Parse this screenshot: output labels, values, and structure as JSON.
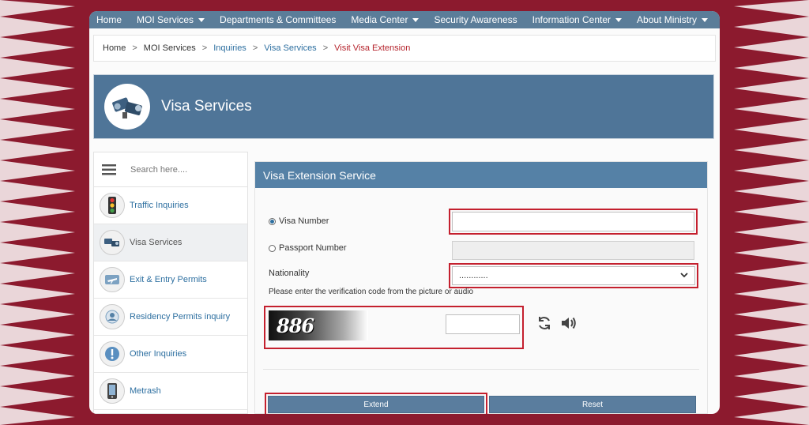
{
  "colors": {
    "maroon": "#7a1426",
    "accent": "#5581a6",
    "highlight": "#c4202e"
  },
  "topnav": [
    {
      "label": "Home",
      "dropdown": false
    },
    {
      "label": "MOI Services",
      "dropdown": true
    },
    {
      "label": "Departments & Committees",
      "dropdown": false
    },
    {
      "label": "Media Center",
      "dropdown": true
    },
    {
      "label": "Security Awareness",
      "dropdown": false
    },
    {
      "label": "Information Center",
      "dropdown": true
    },
    {
      "label": "About Ministry",
      "dropdown": true
    }
  ],
  "breadcrumb": {
    "home": "Home",
    "moi_services": "MOI Services",
    "inquiries": "Inquiries",
    "visa_services": "Visa Services",
    "current": "Visit Visa Extension",
    "separator": ">"
  },
  "banner": {
    "title": "Visa Services",
    "icon": "cameras-icon"
  },
  "sidebar": {
    "search_placeholder": "Search here....",
    "items": [
      {
        "label": "Traffic Inquiries",
        "icon": "traffic-light-icon"
      },
      {
        "label": "Visa Services",
        "icon": "cameras-icon"
      },
      {
        "label": "Exit & Entry Permits",
        "icon": "airplane-icon"
      },
      {
        "label": "Residency Permits inquiry",
        "icon": "id-card-icon"
      },
      {
        "label": "Other Inquiries",
        "icon": "info-icon"
      },
      {
        "label": "Metrash",
        "icon": "phone-icon"
      }
    ]
  },
  "form": {
    "title": "Visa Extension Service",
    "visa_number_label": "Visa Number",
    "visa_number_value": "",
    "passport_number_label": "Passport Number",
    "passport_number_value": "",
    "nationality_label": "Nationality",
    "nationality_value": "............",
    "verification_hint": "Please enter the verification code from the picture or audio",
    "captcha_text": "886",
    "captcha_input_value": "",
    "extend_label": "Extend",
    "reset_label": "Reset"
  }
}
